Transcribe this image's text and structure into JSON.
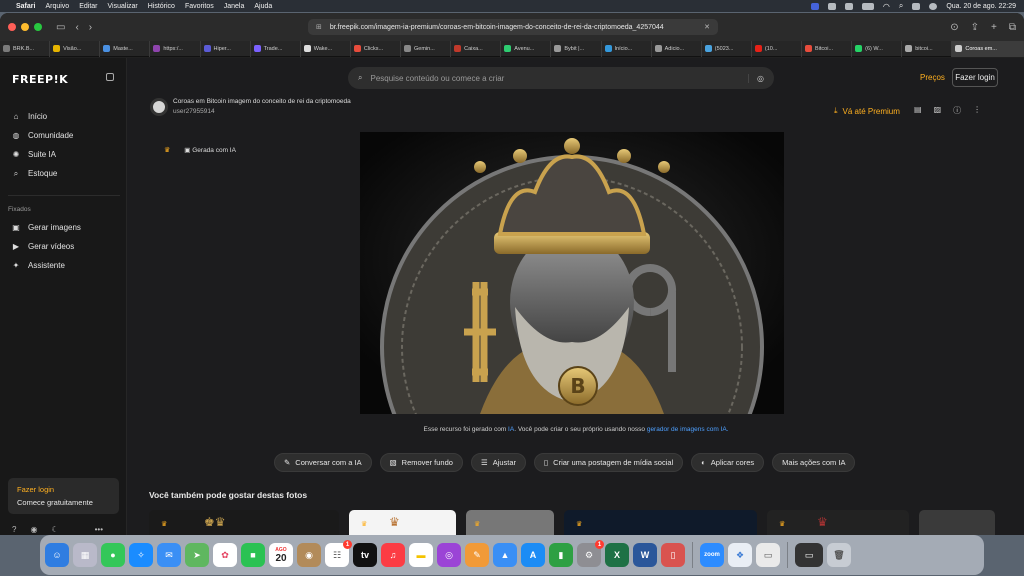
{
  "menubar": {
    "app": "Safari",
    "menus": [
      "Arquivo",
      "Editar",
      "Visualizar",
      "Histórico",
      "Favoritos",
      "Janela",
      "Ajuda"
    ],
    "clock": "Qua. 20 de ago.  22:29"
  },
  "browser": {
    "url": "br.freepik.com/imagem-ia-premium/coroas-em-bitcoin-imagem-do-conceito-de-rei-da-criptomoeda_4257044",
    "tabs": [
      {
        "label": "BRK.B...",
        "color": "#7a7a7a"
      },
      {
        "label": "Visão...",
        "color": "#e6b400"
      },
      {
        "label": "Maste...",
        "color": "#4a90e2"
      },
      {
        "label": "https:/...",
        "color": "#8e44ad"
      },
      {
        "label": "Hiper...",
        "color": "#5b5bd6"
      },
      {
        "label": "Trade...",
        "color": "#7b61ff"
      },
      {
        "label": "Wake...",
        "color": "#dddddd"
      },
      {
        "label": "Clicks...",
        "color": "#e74c3c"
      },
      {
        "label": "Gemin...",
        "color": "#888888"
      },
      {
        "label": "Caixa...",
        "color": "#c0392b"
      },
      {
        "label": "Avenu...",
        "color": "#2ecc71"
      },
      {
        "label": "Bybit |...",
        "color": "#999999"
      },
      {
        "label": "Início...",
        "color": "#3498db"
      },
      {
        "label": "Adicio...",
        "color": "#999999"
      },
      {
        "label": "(5023...",
        "color": "#4aa3df"
      },
      {
        "label": "(10...",
        "color": "#e62117"
      },
      {
        "label": "Bitcoi...",
        "color": "#e74c3c"
      },
      {
        "label": "(6) W...",
        "color": "#25d366"
      },
      {
        "label": "bitcoi...",
        "color": "#aaaaaa"
      },
      {
        "label": "Coroas em...",
        "color": "#cccccc"
      }
    ]
  },
  "sidebar": {
    "logo": "FREEP!K",
    "nav": [
      {
        "label": "Início",
        "icon": "home-icon",
        "glyph": "⌂"
      },
      {
        "label": "Comunidade",
        "icon": "globe-icon",
        "glyph": "◍"
      },
      {
        "label": "Suite IA",
        "icon": "ai-icon",
        "glyph": "✺"
      },
      {
        "label": "Estoque",
        "icon": "search-icon",
        "glyph": "⌕"
      }
    ],
    "pinned_label": "Fixados",
    "pinned": [
      {
        "label": "Gerar imagens",
        "icon": "image-icon",
        "glyph": "▣"
      },
      {
        "label": "Gerar vídeos",
        "icon": "video-icon",
        "glyph": "▶"
      },
      {
        "label": "Assistente",
        "icon": "assistant-icon",
        "glyph": "✦"
      }
    ],
    "login_title": "Fazer login",
    "login_sub": "Comece gratuitamente"
  },
  "header": {
    "search_placeholder": "Pesquise conteúdo ou comece a criar",
    "precos": "Preços",
    "login": "Fazer login"
  },
  "asset": {
    "title": "Coroas em Bitcoin imagem do conceito de rei da criptomoeda",
    "user": "user27955914",
    "premium": "Vá até Premium",
    "generated": "Gerada com IA",
    "caption_a": "Esse recurso foi gerado com",
    "caption_ia": "IA",
    "caption_b": ". Você pode criar o seu próprio usando nosso",
    "caption_link": "gerador de imagens com IA."
  },
  "actions": [
    "Conversar com a IA",
    "Remover fundo",
    "Ajustar",
    "Criar uma postagem de mídia social",
    "Aplicar cores",
    "Mais ações com IA"
  ],
  "related_title": "Você também pode gostar destas fotos",
  "dock": {
    "calendar_month": "AGO",
    "calendar_day": "20",
    "reminders_badge": "1",
    "settings_badge": "1",
    "zoom_label": "zoom"
  }
}
